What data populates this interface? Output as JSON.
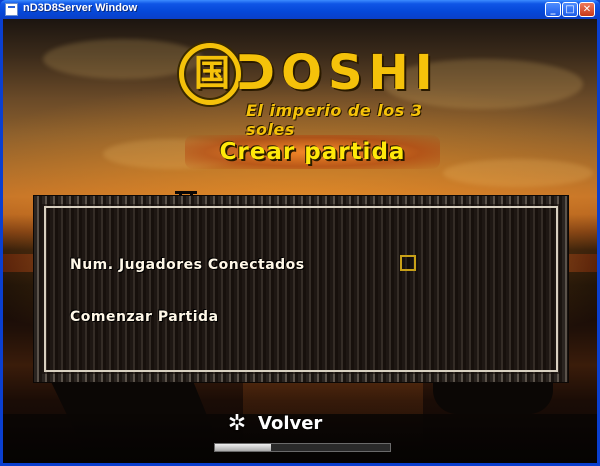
{
  "window": {
    "title": "nD3D8Server Window",
    "minimize_glyph": "_",
    "maximize_glyph": "□",
    "close_glyph": "✕"
  },
  "logo": {
    "kanji": "国",
    "word": "ᑐOSHI",
    "subtitle": "El imperio de los 3 soles",
    "color": "#f5c20a"
  },
  "screen": {
    "title": "Crear partida",
    "title_color": "#ffe90a"
  },
  "menu": {
    "players_label": "Num. Jugadores Conectados",
    "start_label": "Comenzar Partida",
    "checkbox_checked": false
  },
  "back": {
    "icon": "shuriken-icon",
    "icon_glyph": "✲",
    "label": "Volver"
  },
  "loading": {
    "progress": 0.32
  }
}
